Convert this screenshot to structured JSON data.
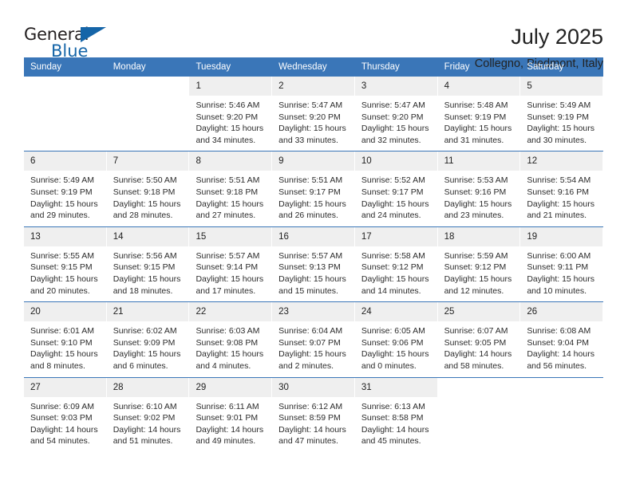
{
  "brand": {
    "name_top": "General",
    "name_bottom": "Blue",
    "accent_color": "#1565a8"
  },
  "header": {
    "title": "July 2025",
    "location": "Collegno, Piedmont, Italy"
  },
  "theme": {
    "header_blue": "#3a76b8",
    "date_band_gray": "#efefef",
    "text": "#222222"
  },
  "calendar": {
    "weekday_headers": [
      "Sunday",
      "Monday",
      "Tuesday",
      "Wednesday",
      "Thursday",
      "Friday",
      "Saturday"
    ],
    "labels": {
      "sunrise": "Sunrise:",
      "sunset": "Sunset:",
      "daylight": "Daylight:"
    },
    "weeks": [
      [
        {
          "day": "",
          "sunrise": "",
          "sunset": "",
          "daylight": "",
          "blank": true
        },
        {
          "day": "",
          "sunrise": "",
          "sunset": "",
          "daylight": "",
          "blank": true
        },
        {
          "day": "1",
          "sunrise": "Sunrise: 5:46 AM",
          "sunset": "Sunset: 9:20 PM",
          "daylight": "Daylight: 15 hours and 34 minutes."
        },
        {
          "day": "2",
          "sunrise": "Sunrise: 5:47 AM",
          "sunset": "Sunset: 9:20 PM",
          "daylight": "Daylight: 15 hours and 33 minutes."
        },
        {
          "day": "3",
          "sunrise": "Sunrise: 5:47 AM",
          "sunset": "Sunset: 9:20 PM",
          "daylight": "Daylight: 15 hours and 32 minutes."
        },
        {
          "day": "4",
          "sunrise": "Sunrise: 5:48 AM",
          "sunset": "Sunset: 9:19 PM",
          "daylight": "Daylight: 15 hours and 31 minutes."
        },
        {
          "day": "5",
          "sunrise": "Sunrise: 5:49 AM",
          "sunset": "Sunset: 9:19 PM",
          "daylight": "Daylight: 15 hours and 30 minutes."
        }
      ],
      [
        {
          "day": "6",
          "sunrise": "Sunrise: 5:49 AM",
          "sunset": "Sunset: 9:19 PM",
          "daylight": "Daylight: 15 hours and 29 minutes."
        },
        {
          "day": "7",
          "sunrise": "Sunrise: 5:50 AM",
          "sunset": "Sunset: 9:18 PM",
          "daylight": "Daylight: 15 hours and 28 minutes."
        },
        {
          "day": "8",
          "sunrise": "Sunrise: 5:51 AM",
          "sunset": "Sunset: 9:18 PM",
          "daylight": "Daylight: 15 hours and 27 minutes."
        },
        {
          "day": "9",
          "sunrise": "Sunrise: 5:51 AM",
          "sunset": "Sunset: 9:17 PM",
          "daylight": "Daylight: 15 hours and 26 minutes."
        },
        {
          "day": "10",
          "sunrise": "Sunrise: 5:52 AM",
          "sunset": "Sunset: 9:17 PM",
          "daylight": "Daylight: 15 hours and 24 minutes."
        },
        {
          "day": "11",
          "sunrise": "Sunrise: 5:53 AM",
          "sunset": "Sunset: 9:16 PM",
          "daylight": "Daylight: 15 hours and 23 minutes."
        },
        {
          "day": "12",
          "sunrise": "Sunrise: 5:54 AM",
          "sunset": "Sunset: 9:16 PM",
          "daylight": "Daylight: 15 hours and 21 minutes."
        }
      ],
      [
        {
          "day": "13",
          "sunrise": "Sunrise: 5:55 AM",
          "sunset": "Sunset: 9:15 PM",
          "daylight": "Daylight: 15 hours and 20 minutes."
        },
        {
          "day": "14",
          "sunrise": "Sunrise: 5:56 AM",
          "sunset": "Sunset: 9:15 PM",
          "daylight": "Daylight: 15 hours and 18 minutes."
        },
        {
          "day": "15",
          "sunrise": "Sunrise: 5:57 AM",
          "sunset": "Sunset: 9:14 PM",
          "daylight": "Daylight: 15 hours and 17 minutes."
        },
        {
          "day": "16",
          "sunrise": "Sunrise: 5:57 AM",
          "sunset": "Sunset: 9:13 PM",
          "daylight": "Daylight: 15 hours and 15 minutes."
        },
        {
          "day": "17",
          "sunrise": "Sunrise: 5:58 AM",
          "sunset": "Sunset: 9:12 PM",
          "daylight": "Daylight: 15 hours and 14 minutes."
        },
        {
          "day": "18",
          "sunrise": "Sunrise: 5:59 AM",
          "sunset": "Sunset: 9:12 PM",
          "daylight": "Daylight: 15 hours and 12 minutes."
        },
        {
          "day": "19",
          "sunrise": "Sunrise: 6:00 AM",
          "sunset": "Sunset: 9:11 PM",
          "daylight": "Daylight: 15 hours and 10 minutes."
        }
      ],
      [
        {
          "day": "20",
          "sunrise": "Sunrise: 6:01 AM",
          "sunset": "Sunset: 9:10 PM",
          "daylight": "Daylight: 15 hours and 8 minutes."
        },
        {
          "day": "21",
          "sunrise": "Sunrise: 6:02 AM",
          "sunset": "Sunset: 9:09 PM",
          "daylight": "Daylight: 15 hours and 6 minutes."
        },
        {
          "day": "22",
          "sunrise": "Sunrise: 6:03 AM",
          "sunset": "Sunset: 9:08 PM",
          "daylight": "Daylight: 15 hours and 4 minutes."
        },
        {
          "day": "23",
          "sunrise": "Sunrise: 6:04 AM",
          "sunset": "Sunset: 9:07 PM",
          "daylight": "Daylight: 15 hours and 2 minutes."
        },
        {
          "day": "24",
          "sunrise": "Sunrise: 6:05 AM",
          "sunset": "Sunset: 9:06 PM",
          "daylight": "Daylight: 15 hours and 0 minutes."
        },
        {
          "day": "25",
          "sunrise": "Sunrise: 6:07 AM",
          "sunset": "Sunset: 9:05 PM",
          "daylight": "Daylight: 14 hours and 58 minutes."
        },
        {
          "day": "26",
          "sunrise": "Sunrise: 6:08 AM",
          "sunset": "Sunset: 9:04 PM",
          "daylight": "Daylight: 14 hours and 56 minutes."
        }
      ],
      [
        {
          "day": "27",
          "sunrise": "Sunrise: 6:09 AM",
          "sunset": "Sunset: 9:03 PM",
          "daylight": "Daylight: 14 hours and 54 minutes."
        },
        {
          "day": "28",
          "sunrise": "Sunrise: 6:10 AM",
          "sunset": "Sunset: 9:02 PM",
          "daylight": "Daylight: 14 hours and 51 minutes."
        },
        {
          "day": "29",
          "sunrise": "Sunrise: 6:11 AM",
          "sunset": "Sunset: 9:01 PM",
          "daylight": "Daylight: 14 hours and 49 minutes."
        },
        {
          "day": "30",
          "sunrise": "Sunrise: 6:12 AM",
          "sunset": "Sunset: 8:59 PM",
          "daylight": "Daylight: 14 hours and 47 minutes."
        },
        {
          "day": "31",
          "sunrise": "Sunrise: 6:13 AM",
          "sunset": "Sunset: 8:58 PM",
          "daylight": "Daylight: 14 hours and 45 minutes."
        },
        {
          "day": "",
          "sunrise": "",
          "sunset": "",
          "daylight": "",
          "blank": true
        },
        {
          "day": "",
          "sunrise": "",
          "sunset": "",
          "daylight": "",
          "blank": true
        }
      ]
    ]
  }
}
